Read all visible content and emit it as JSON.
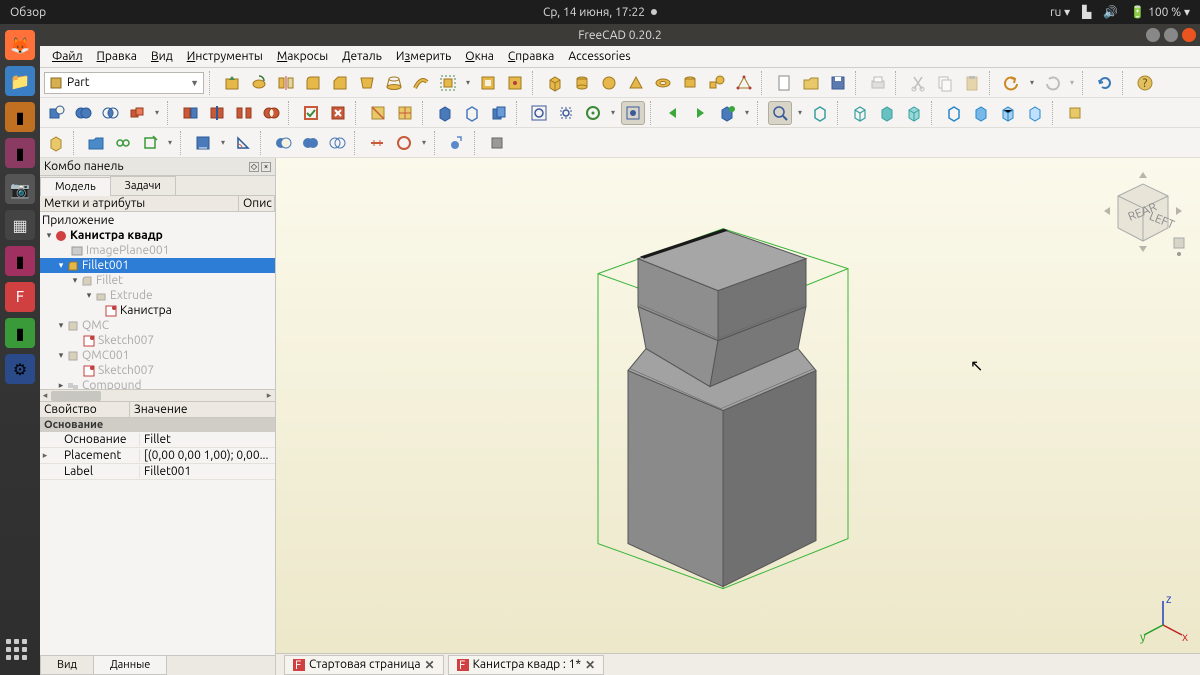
{
  "ubuntu": {
    "activities": "Обзор",
    "datetime": "Ср, 14 июня, 17:22",
    "lang": "ru",
    "battery": "100 %"
  },
  "window": {
    "title": "FreeCAD 0.20.2"
  },
  "menus": [
    "Файл",
    "Правка",
    "Вид",
    "Инструменты",
    "Макросы",
    "Деталь",
    "Измерить",
    "Окна",
    "Справка",
    "Accessories"
  ],
  "workbench": {
    "label": "Part"
  },
  "combo": {
    "title": "Комбо панель",
    "tab_model": "Модель",
    "tab_tasks": "Задачи",
    "col_labels": "Метки и атрибуты",
    "col_desc": "Опис",
    "app_label": "Приложение",
    "tree": {
      "doc": "Канистра квадр",
      "items": [
        "ImagePlane001",
        "Fillet001",
        "Fillet",
        "Extrude",
        "Канистра",
        "QMC",
        "Sketch007",
        "QMC001",
        "Sketch007",
        "Compound"
      ]
    },
    "prop_header_name": "Свойство",
    "prop_header_value": "Значение",
    "prop_group": "Основание",
    "props": [
      {
        "name": "Основание",
        "value": "Fillet"
      },
      {
        "name": "Placement",
        "value": "[(0,00 0,00 1,00); 0,00..."
      },
      {
        "name": "Label",
        "value": "Fillet001"
      }
    ],
    "bottom_tab_view": "Вид",
    "bottom_tab_data": "Данные"
  },
  "doc_tabs": {
    "start": "Стартовая страница",
    "doc": "Канистра квадр : 1*"
  },
  "navcube": {
    "rear": "REAR",
    "left": "LEFT"
  },
  "axes": {
    "x": "x",
    "y": "y",
    "z": "z"
  }
}
